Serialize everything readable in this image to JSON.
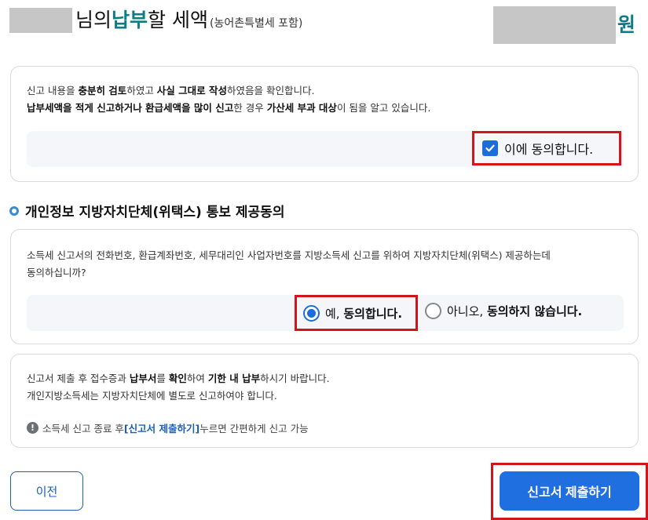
{
  "header": {
    "title_prefix": "님의 ",
    "title_accent": "납부",
    "title_suffix": " 할 세액",
    "title_note": "(농어촌특별세 포함)",
    "currency": "원"
  },
  "confirm": {
    "line1": [
      "신고 내용을 ",
      "충분히 검토",
      "하였고 ",
      "사실 그대로 작성",
      "하였음을 확인합니다."
    ],
    "line2": [
      "납부세액을 적게 신고하거나 환급세액을 많이 신고",
      "한 경우 ",
      "가산세 부과 대상",
      "이 됨을 알고 있습니다."
    ],
    "agree_label": "이에 동의합니다.",
    "agree_checked": true
  },
  "consent": {
    "section_title": "개인정보 지방자치단체(위택스) 통보 제공동의",
    "line1": "소득세 신고서의 전화번호, 환급계좌번호, 세무대리인 사업자번호를 지방소득세 신고를 위하여 지방자치단체(위택스) 제공하는데",
    "line2": "동의하십니까?",
    "yes_prefix": "예, ",
    "yes_bold": "동의합니다.",
    "no_prefix": "아니오, ",
    "no_bold": "동의하지 않습니다.",
    "selected": "yes"
  },
  "notice": {
    "line1": [
      "신고서 제출 후 접수증과 ",
      "납부서",
      "를 ",
      "확인",
      "하여 ",
      "기한 내 납부",
      "하시기 바랍니다."
    ],
    "line2": "개인지방소득세는 지방자치단체에 별도로 신고하여야 합니다.",
    "info_prefix": "소득세 신고 종료 후 ",
    "info_link": "[신고서 제출하기]",
    "info_suffix": " 누르면 간편하게 신고 가능",
    "info_icon": "exclamation-circle-icon"
  },
  "buttons": {
    "prev": "이전",
    "submit": "신고서 제출하기"
  },
  "colors": {
    "accent": "#0e7c86",
    "primary": "#1f6fe0",
    "highlight": "#d0161b"
  }
}
